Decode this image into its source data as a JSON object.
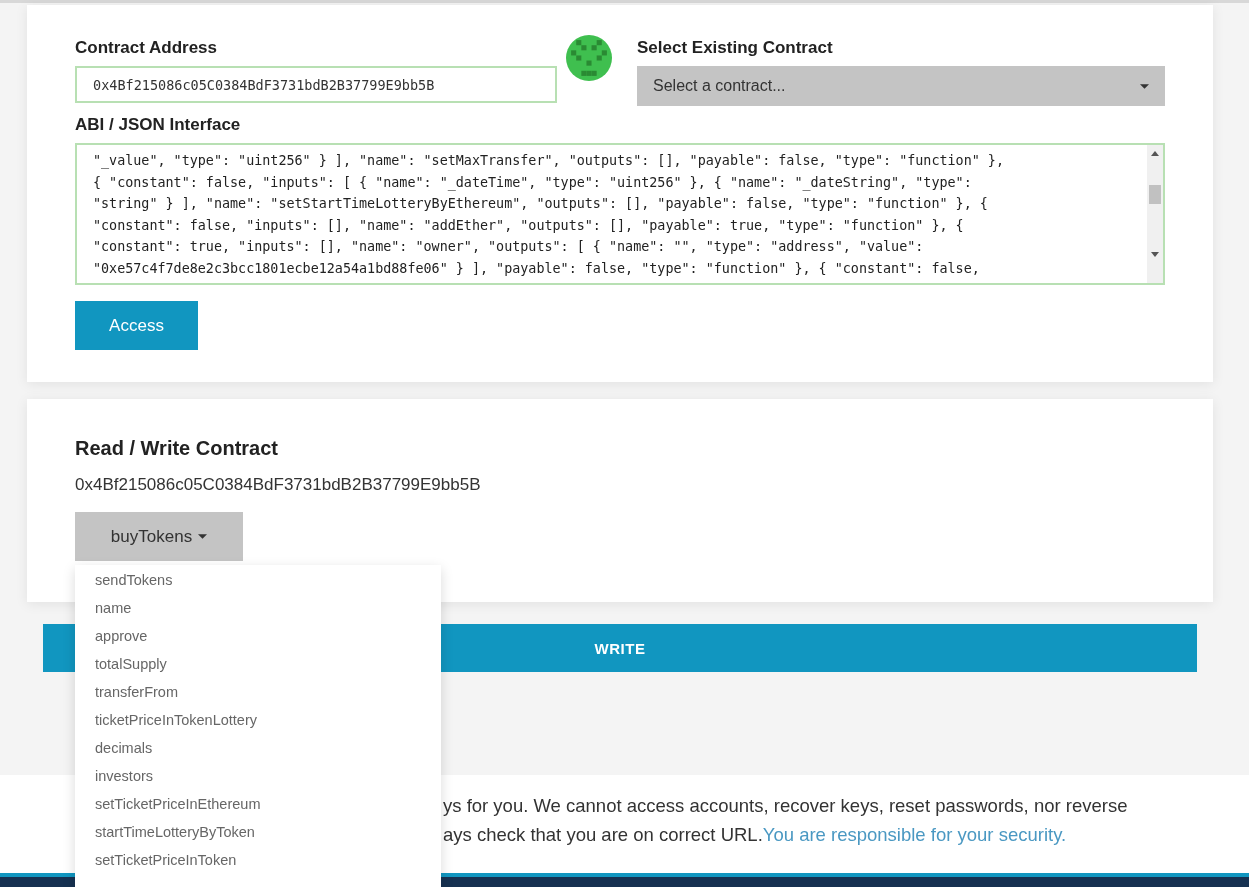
{
  "access_card": {
    "address_label": "Contract Address",
    "address_value": "0x4Bf215086c05C0384BdF3731bdB2B37799E9bb5B",
    "existing_label": "Select Existing Contract",
    "existing_select": "Select a contract...",
    "abi_label": "ABI / JSON Interface",
    "abi_lines": [
      "\"_value\", \"type\": \"uint256\" } ], \"name\": \"setMaxTransfer\", \"outputs\": [], \"payable\": false, \"type\": \"function\" },",
      "{ \"constant\": false, \"inputs\": [ { \"name\": \"_dateTime\", \"type\": \"uint256\" }, { \"name\": \"_dateString\", \"type\":",
      "\"string\" } ], \"name\": \"setStartTimeLotteryByEthereum\", \"outputs\": [], \"payable\": false, \"type\": \"function\" }, {",
      "\"constant\": false, \"inputs\": [], \"name\": \"addEther\", \"outputs\": [], \"payable\": true, \"type\": \"function\" }, {",
      "\"constant\": true, \"inputs\": [], \"name\": \"owner\", \"outputs\": [ { \"name\": \"\", \"type\": \"address\", \"value\":",
      "\"0xe57c4f7de8e2c3bcc1801ecbe12a54a1bd88fe06\" } ], \"payable\": false, \"type\": \"function\" }, { \"constant\": false,"
    ],
    "access_button": "Access"
  },
  "contract_card": {
    "title": "Read / Write Contract",
    "address": "0x4Bf215086c05C0384BdF3731bdB2B37799E9bb5B",
    "function_button": "buyTokens",
    "menu_open": true,
    "menu_items": [
      "sendTokens",
      "name",
      "approve",
      "totalSupply",
      "transferFrom",
      "ticketPriceInTokenLottery",
      "decimals",
      "investors",
      "setTicketPriceInEthereum",
      "startTimeLotteryByToken",
      "setTicketPriceInToken"
    ]
  },
  "write_button": "WRITE",
  "footer": {
    "lines": [
      "ys for you. We cannot access accounts, recover keys, reset passwords, nor reverse",
      "ays check that you are on correct URL."
    ],
    "link": "You are responsible for your security."
  }
}
